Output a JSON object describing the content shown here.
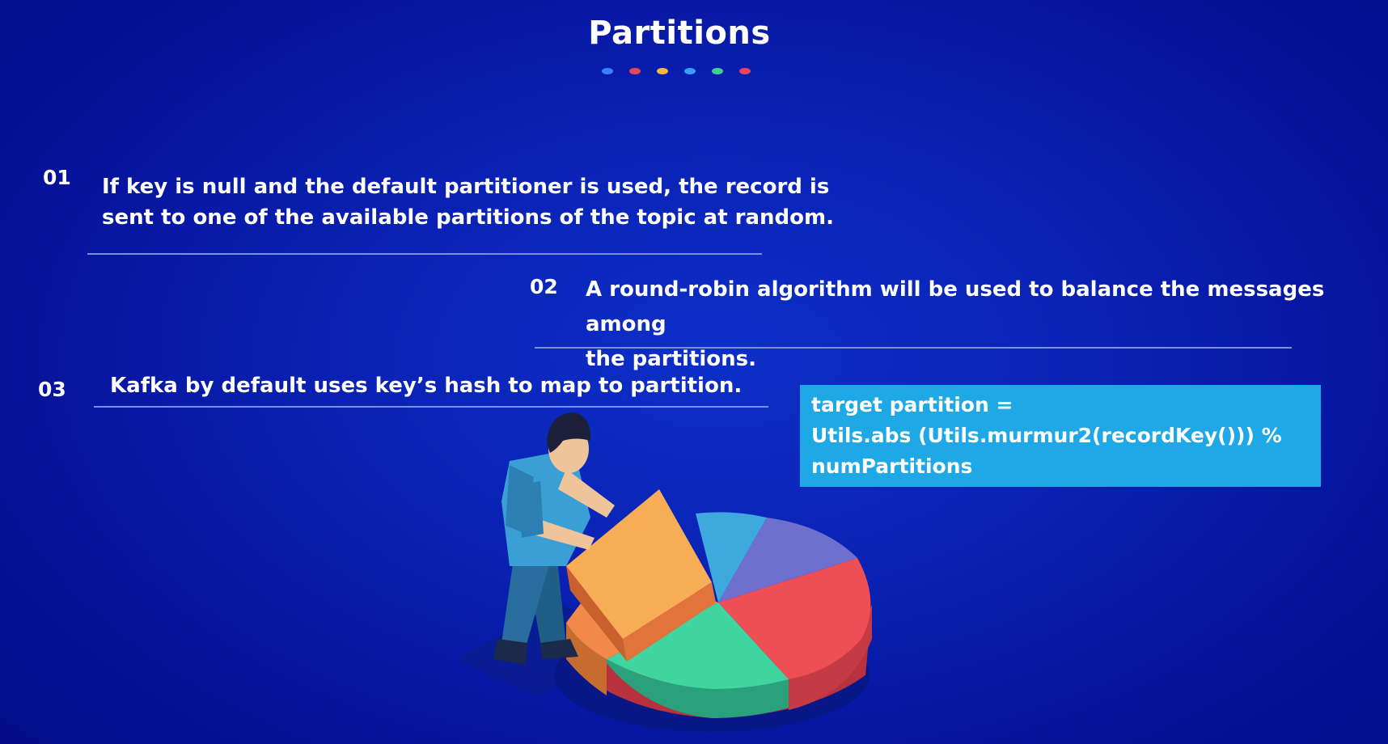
{
  "title": "Partitions",
  "accent_dots": [
    "#3b7fff",
    "#e8455a",
    "#f5b93a",
    "#3b9cff",
    "#3fcf8e",
    "#e8455a"
  ],
  "items": [
    {
      "number": "01",
      "lines": [
        "If key is null and the default  partitioner is used, the record is",
        "sent  to one of the available partitions of  the topic at random."
      ]
    },
    {
      "number": "02",
      "lines": [
        "A round-robin algorithm will be used  to balance the messages among",
        "the partitions."
      ]
    },
    {
      "number": "03",
      "lines": [
        "Kafka by default uses key’s hash to map to partition."
      ]
    }
  ],
  "code_box": {
    "lines": [
      "target partition =",
      "Utils.abs (Utils.murmur2(recordKey())) %",
      "numPartitions"
    ],
    "background": "#1ea8e6"
  },
  "illustration": {
    "icon": "person-with-pie-chart-illustration"
  }
}
